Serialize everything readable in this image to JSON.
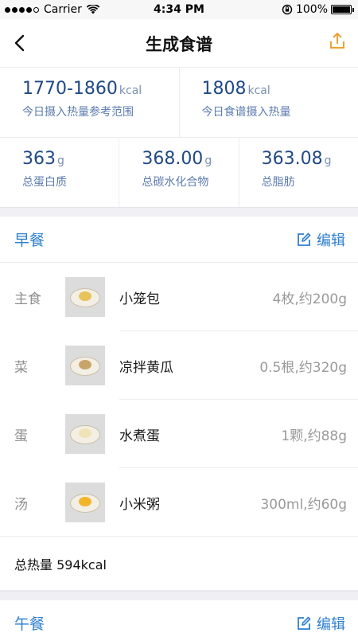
{
  "status_bar": {
    "carrier": "Carrier",
    "time": "4:34 PM",
    "battery": "100%"
  },
  "nav": {
    "title": "生成食谱"
  },
  "summary": {
    "reference": {
      "value": "1770-1860",
      "unit": "kcal",
      "label": "今日摄入热量参考范围"
    },
    "recipe": {
      "value": "1808",
      "unit": "kcal",
      "label": "今日食谱摄入热量"
    },
    "protein": {
      "value": "363",
      "unit": "g",
      "label": "总蛋白质"
    },
    "carbs": {
      "value": "368.00",
      "unit": "g",
      "label": "总碳水化合物"
    },
    "fat": {
      "value": "363.08",
      "unit": "g",
      "label": "总脂肪"
    }
  },
  "meals": [
    {
      "name": "早餐",
      "edit_label": "编辑",
      "items": [
        {
          "category": "主食",
          "name": "小笼包",
          "qty": "4枚,约200g"
        },
        {
          "category": "菜",
          "name": "凉拌黄瓜",
          "qty": "0.5根,约320g"
        },
        {
          "category": "蛋",
          "name": "水煮蛋",
          "qty": "1颗,约88g"
        },
        {
          "category": "汤",
          "name": "小米粥",
          "qty": "300ml,约60g"
        }
      ],
      "total": "总热量 594kcal"
    },
    {
      "name": "午餐",
      "edit_label": "编辑"
    }
  ],
  "colors": {
    "accent": "#2f7fd0",
    "value": "#214a86",
    "share_icon": "#f0a030"
  },
  "icons": {
    "back": "chevron-left-icon",
    "share": "share-icon",
    "edit": "edit-icon"
  }
}
